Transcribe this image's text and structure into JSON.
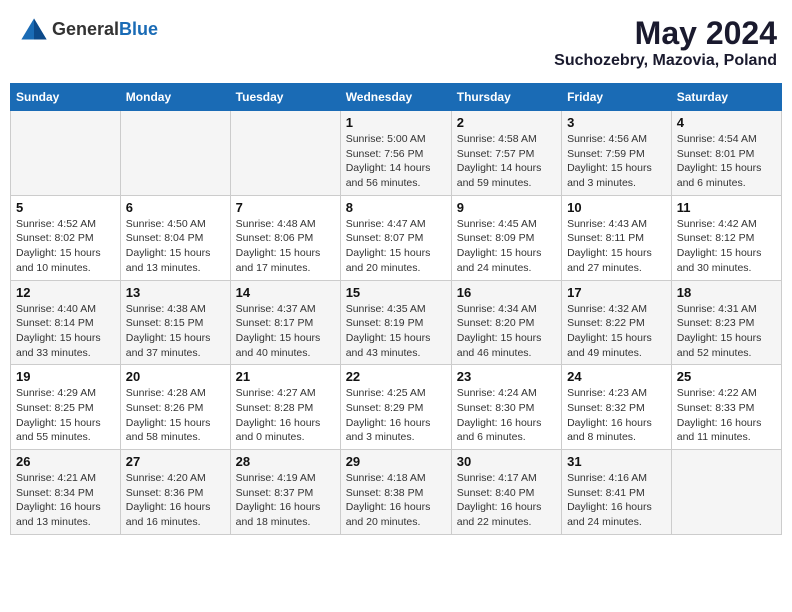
{
  "header": {
    "logo_general": "General",
    "logo_blue": "Blue",
    "month": "May 2024",
    "location": "Suchozebry, Mazovia, Poland"
  },
  "weekdays": [
    "Sunday",
    "Monday",
    "Tuesday",
    "Wednesday",
    "Thursday",
    "Friday",
    "Saturday"
  ],
  "weeks": [
    [
      {
        "day": "",
        "info": ""
      },
      {
        "day": "",
        "info": ""
      },
      {
        "day": "",
        "info": ""
      },
      {
        "day": "1",
        "info": "Sunrise: 5:00 AM\nSunset: 7:56 PM\nDaylight: 14 hours\nand 56 minutes."
      },
      {
        "day": "2",
        "info": "Sunrise: 4:58 AM\nSunset: 7:57 PM\nDaylight: 14 hours\nand 59 minutes."
      },
      {
        "day": "3",
        "info": "Sunrise: 4:56 AM\nSunset: 7:59 PM\nDaylight: 15 hours\nand 3 minutes."
      },
      {
        "day": "4",
        "info": "Sunrise: 4:54 AM\nSunset: 8:01 PM\nDaylight: 15 hours\nand 6 minutes."
      }
    ],
    [
      {
        "day": "5",
        "info": "Sunrise: 4:52 AM\nSunset: 8:02 PM\nDaylight: 15 hours\nand 10 minutes."
      },
      {
        "day": "6",
        "info": "Sunrise: 4:50 AM\nSunset: 8:04 PM\nDaylight: 15 hours\nand 13 minutes."
      },
      {
        "day": "7",
        "info": "Sunrise: 4:48 AM\nSunset: 8:06 PM\nDaylight: 15 hours\nand 17 minutes."
      },
      {
        "day": "8",
        "info": "Sunrise: 4:47 AM\nSunset: 8:07 PM\nDaylight: 15 hours\nand 20 minutes."
      },
      {
        "day": "9",
        "info": "Sunrise: 4:45 AM\nSunset: 8:09 PM\nDaylight: 15 hours\nand 24 minutes."
      },
      {
        "day": "10",
        "info": "Sunrise: 4:43 AM\nSunset: 8:11 PM\nDaylight: 15 hours\nand 27 minutes."
      },
      {
        "day": "11",
        "info": "Sunrise: 4:42 AM\nSunset: 8:12 PM\nDaylight: 15 hours\nand 30 minutes."
      }
    ],
    [
      {
        "day": "12",
        "info": "Sunrise: 4:40 AM\nSunset: 8:14 PM\nDaylight: 15 hours\nand 33 minutes."
      },
      {
        "day": "13",
        "info": "Sunrise: 4:38 AM\nSunset: 8:15 PM\nDaylight: 15 hours\nand 37 minutes."
      },
      {
        "day": "14",
        "info": "Sunrise: 4:37 AM\nSunset: 8:17 PM\nDaylight: 15 hours\nand 40 minutes."
      },
      {
        "day": "15",
        "info": "Sunrise: 4:35 AM\nSunset: 8:19 PM\nDaylight: 15 hours\nand 43 minutes."
      },
      {
        "day": "16",
        "info": "Sunrise: 4:34 AM\nSunset: 8:20 PM\nDaylight: 15 hours\nand 46 minutes."
      },
      {
        "day": "17",
        "info": "Sunrise: 4:32 AM\nSunset: 8:22 PM\nDaylight: 15 hours\nand 49 minutes."
      },
      {
        "day": "18",
        "info": "Sunrise: 4:31 AM\nSunset: 8:23 PM\nDaylight: 15 hours\nand 52 minutes."
      }
    ],
    [
      {
        "day": "19",
        "info": "Sunrise: 4:29 AM\nSunset: 8:25 PM\nDaylight: 15 hours\nand 55 minutes."
      },
      {
        "day": "20",
        "info": "Sunrise: 4:28 AM\nSunset: 8:26 PM\nDaylight: 15 hours\nand 58 minutes."
      },
      {
        "day": "21",
        "info": "Sunrise: 4:27 AM\nSunset: 8:28 PM\nDaylight: 16 hours\nand 0 minutes."
      },
      {
        "day": "22",
        "info": "Sunrise: 4:25 AM\nSunset: 8:29 PM\nDaylight: 16 hours\nand 3 minutes."
      },
      {
        "day": "23",
        "info": "Sunrise: 4:24 AM\nSunset: 8:30 PM\nDaylight: 16 hours\nand 6 minutes."
      },
      {
        "day": "24",
        "info": "Sunrise: 4:23 AM\nSunset: 8:32 PM\nDaylight: 16 hours\nand 8 minutes."
      },
      {
        "day": "25",
        "info": "Sunrise: 4:22 AM\nSunset: 8:33 PM\nDaylight: 16 hours\nand 11 minutes."
      }
    ],
    [
      {
        "day": "26",
        "info": "Sunrise: 4:21 AM\nSunset: 8:34 PM\nDaylight: 16 hours\nand 13 minutes."
      },
      {
        "day": "27",
        "info": "Sunrise: 4:20 AM\nSunset: 8:36 PM\nDaylight: 16 hours\nand 16 minutes."
      },
      {
        "day": "28",
        "info": "Sunrise: 4:19 AM\nSunset: 8:37 PM\nDaylight: 16 hours\nand 18 minutes."
      },
      {
        "day": "29",
        "info": "Sunrise: 4:18 AM\nSunset: 8:38 PM\nDaylight: 16 hours\nand 20 minutes."
      },
      {
        "day": "30",
        "info": "Sunrise: 4:17 AM\nSunset: 8:40 PM\nDaylight: 16 hours\nand 22 minutes."
      },
      {
        "day": "31",
        "info": "Sunrise: 4:16 AM\nSunset: 8:41 PM\nDaylight: 16 hours\nand 24 minutes."
      },
      {
        "day": "",
        "info": ""
      }
    ]
  ]
}
